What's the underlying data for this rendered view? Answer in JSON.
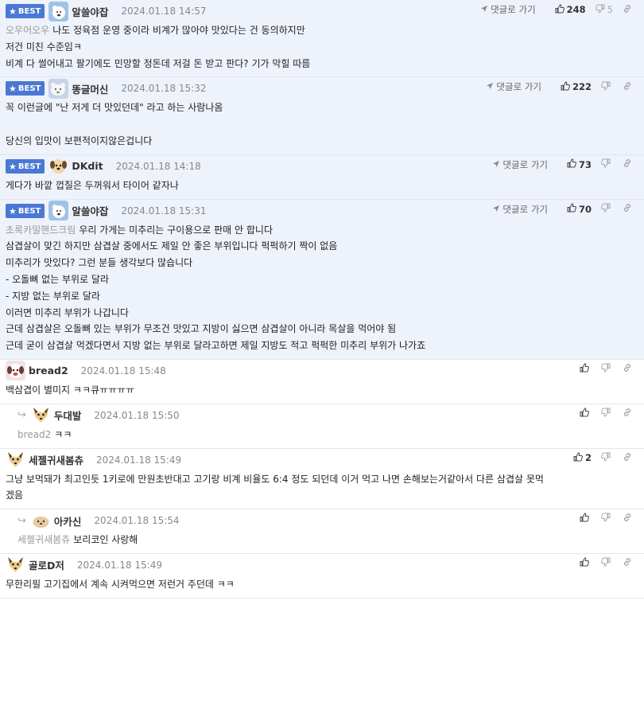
{
  "labels": {
    "best": "BEST",
    "reply_link": "댓글로 가기"
  },
  "comments": [
    {
      "best": true,
      "reply": false,
      "avatar": "polarbear",
      "nick": "알쓸야잡",
      "time": "2024.01.18 14:57",
      "show_link": true,
      "up": "248",
      "down": "5",
      "mention": "오우어오우",
      "lines": [
        "나도 정육점 운영 중이라 비계가 많아야 맛있다는 건 동의하지만",
        "저건 미친 수준임ㅋ",
        "비계 다 썰어내고 팔기에도 민망할 정돈데 저걸 돈 받고 판다? 기가 막힐 따름"
      ]
    },
    {
      "best": true,
      "reply": false,
      "avatar": "polarbear2",
      "nick": "똥글머신",
      "time": "2024.01.18 15:32",
      "show_link": true,
      "up": "222",
      "down": "",
      "mention": "",
      "lines": [
        "꼭 이런글에 \"난 저게 더 맛있던데\" 라고 하는 사람나옴",
        "",
        "당신의 입맛이 보편적이지않은겁니다"
      ]
    },
    {
      "best": true,
      "reply": false,
      "avatar": "dog",
      "nick": "DKdit",
      "time": "2024.01.18 14:18",
      "show_link": true,
      "up": "73",
      "down": "",
      "mention": "",
      "lines": [
        "게다가 바깥 껍질은 두꺼워서 타이어 같자나"
      ]
    },
    {
      "best": true,
      "reply": false,
      "avatar": "polarbear",
      "nick": "알쓸야잡",
      "time": "2024.01.18 15:31",
      "show_link": true,
      "up": "70",
      "down": "",
      "mention": "초록카밀핸드크림",
      "lines": [
        "우리 가게는 미추리는 구이용으로 판매 안 합니다",
        "삼겹살이 맞긴 하지만 삼겹살 중에서도 제일 안 좋은 부위입니다 퍽퍽하기 짝이 없음",
        "미추리가 맛있다? 그런 분들 생각보다 많습니다",
        "- 오돌뼈 없는 부위로 달라",
        "- 지방 없는 부위로 달라",
        "이러면 미추리 부위가 나갑니다",
        "근데 삼겹살은 오돌뼈 있는 부위가 무조건 맛있고 지방이 싫으면 삼겹살이 아니라 목살을 먹어야 됨",
        "근데 굳이 삼겹살 먹겠다면서 지방 없는 부위로 달라고하면 제일 지방도 적고 퍽퍽한 미추리 부위가 나가죠"
      ]
    },
    {
      "best": false,
      "reply": false,
      "avatar": "dog2",
      "nick": "bread2",
      "time": "2024.01.18 15:48",
      "show_link": false,
      "up": "",
      "down": "",
      "mention": "",
      "lines": [
        "백삼겹이 별미지 ㅋㅋ큐ㅠㅠㅠㅠ"
      ]
    },
    {
      "best": false,
      "reply": true,
      "avatar": "fox",
      "nick": "두대발",
      "time": "2024.01.18 15:50",
      "show_link": false,
      "up": "",
      "down": "",
      "mention": "bread2",
      "lines": [
        "ㅋㅋ"
      ]
    },
    {
      "best": false,
      "reply": false,
      "avatar": "fox",
      "nick": "세젤귀새봄츄",
      "time": "2024.01.18 15:49",
      "show_link": false,
      "up": "2",
      "down": "",
      "mention": "",
      "lines": [
        "그냥 보먹돼가 최고인듯 1키로에 만원초반대고 고기랑 비계 비율도 6:4 정도 되던데 이거 먹고 나면 손해보는거같아서 다른 삼겹살 못먹",
        "겠음"
      ]
    },
    {
      "best": false,
      "reply": true,
      "avatar": "seal",
      "nick": "아카신",
      "time": "2024.01.18 15:54",
      "show_link": false,
      "up": "",
      "down": "",
      "mention": "세젤귀새봄츄",
      "lines": [
        "보리코인 사랑해"
      ]
    },
    {
      "best": false,
      "reply": false,
      "avatar": "fox",
      "nick": "골로D저",
      "time": "2024.01.18 15:49",
      "show_link": false,
      "up": "",
      "down": "",
      "mention": "",
      "lines": [
        "무한리필 고기집에서 계속 시켜먹으면 저런거 주던데 ㅋㅋ"
      ]
    }
  ]
}
